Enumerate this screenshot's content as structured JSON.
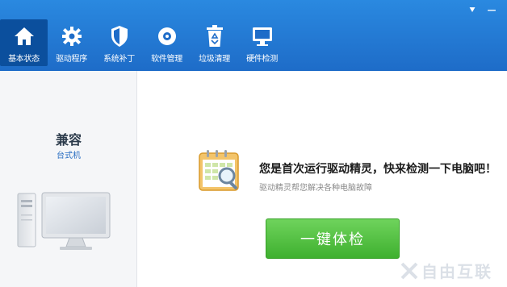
{
  "window_controls": {
    "menu_symbol": "⯆",
    "minimize_symbol": "—"
  },
  "nav": {
    "items": [
      {
        "label": "基本状态",
        "icon": "home-icon",
        "active": true
      },
      {
        "label": "驱动程序",
        "icon": "gear-icon",
        "active": false
      },
      {
        "label": "系统补丁",
        "icon": "shield-icon",
        "active": false
      },
      {
        "label": "软件管理",
        "icon": "disc-icon",
        "active": false
      },
      {
        "label": "垃圾清理",
        "icon": "recycle-bin-icon",
        "active": false
      },
      {
        "label": "硬件检测",
        "icon": "monitor-icon",
        "active": false
      }
    ]
  },
  "device": {
    "name": "兼容",
    "type": "台式机"
  },
  "main": {
    "headline": "您是首次运行驱动精灵，快来检测一下电脑吧！",
    "subline": "驱动精灵帮您解决各种电脑故障",
    "check_button": "一键体检"
  },
  "watermark": {
    "text": "自由互联"
  },
  "colors": {
    "topbar": "#1e6cc8",
    "active_nav": "#0b4f9d",
    "button_green": "#3fb02f"
  }
}
